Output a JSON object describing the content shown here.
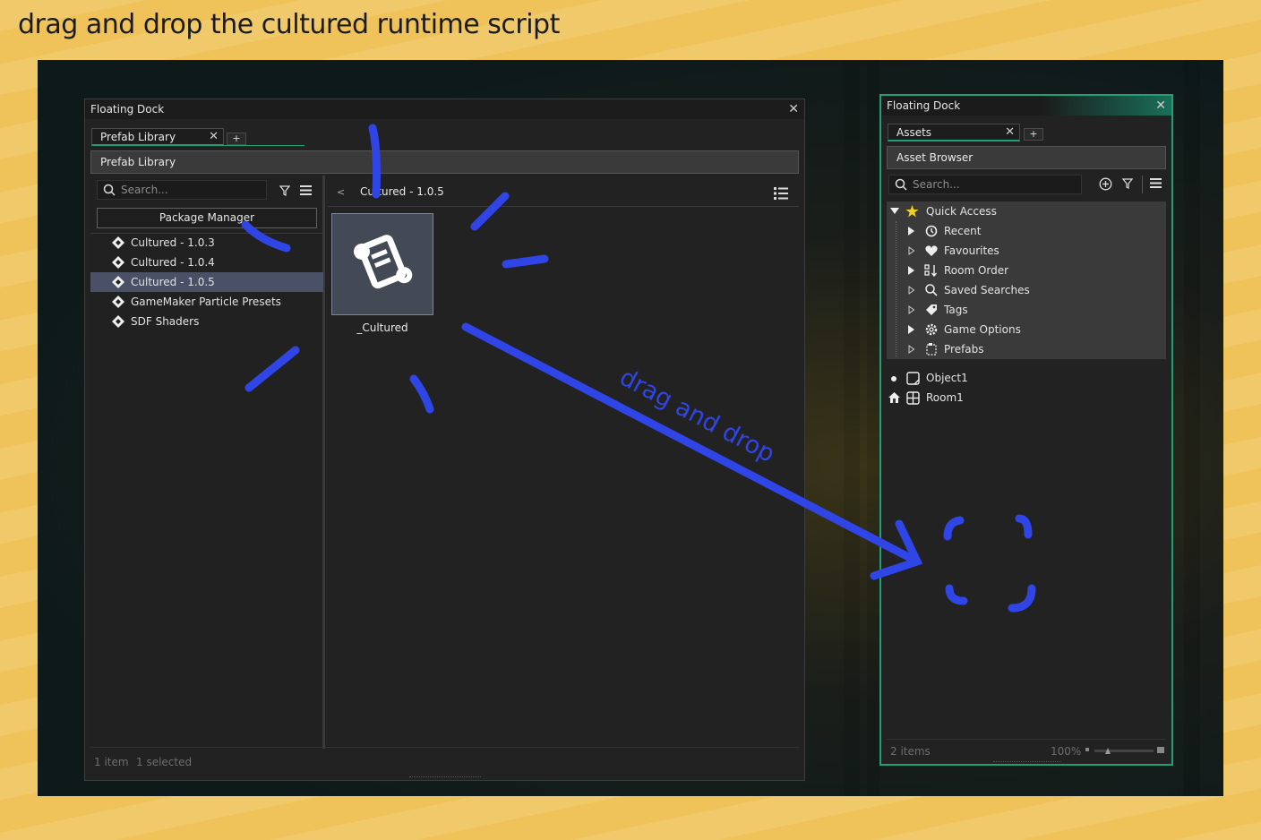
{
  "headline": "drag and drop the cultured runtime script",
  "left_window": {
    "title": "Floating Dock",
    "tab_label": "Prefab Library",
    "tab_plus": "+",
    "section_title": "Prefab Library",
    "search_placeholder": "Search...",
    "package_manager_label": "Package Manager",
    "tree_items": [
      {
        "label": "Cultured - 1.0.3",
        "selected": false
      },
      {
        "label": "Cultured - 1.0.4",
        "selected": false
      },
      {
        "label": "Cultured - 1.0.5",
        "selected": true
      },
      {
        "label": "GameMaker Particle Presets",
        "selected": false
      },
      {
        "label": "SDF Shaders",
        "selected": false
      }
    ],
    "back_label": "<",
    "breadcrumb": "Cultured - 1.0.5",
    "asset_name": "_Cultured",
    "status_items": "1 item",
    "status_selected": "1 selected"
  },
  "right_window": {
    "title": "Floating Dock",
    "tab_label": "Assets",
    "tab_plus": "+",
    "section_title": "Asset Browser",
    "search_placeholder": "Search...",
    "quick_access": "Quick Access",
    "quick_items": [
      {
        "label": "Recent",
        "icon": "history-icon"
      },
      {
        "label": "Favourites",
        "icon": "heart-icon"
      },
      {
        "label": "Room Order",
        "icon": "room-order-icon"
      },
      {
        "label": "Saved Searches",
        "icon": "search-icon"
      },
      {
        "label": "Tags",
        "icon": "tag-icon"
      },
      {
        "label": "Game Options",
        "icon": "gear-icon"
      },
      {
        "label": "Prefabs",
        "icon": "prefab-icon"
      }
    ],
    "assets": [
      {
        "label": "Object1",
        "icon": "object-icon"
      },
      {
        "label": "Room1",
        "icon": "room-icon"
      }
    ],
    "status_items": "2 items",
    "zoom": "100%"
  },
  "annotation_text": "drag and drop",
  "colors": {
    "accent_green": "#1ea078",
    "annotation_blue": "#2f45e6",
    "selection": "#4a5066",
    "background_yellow": "#efc35a"
  }
}
